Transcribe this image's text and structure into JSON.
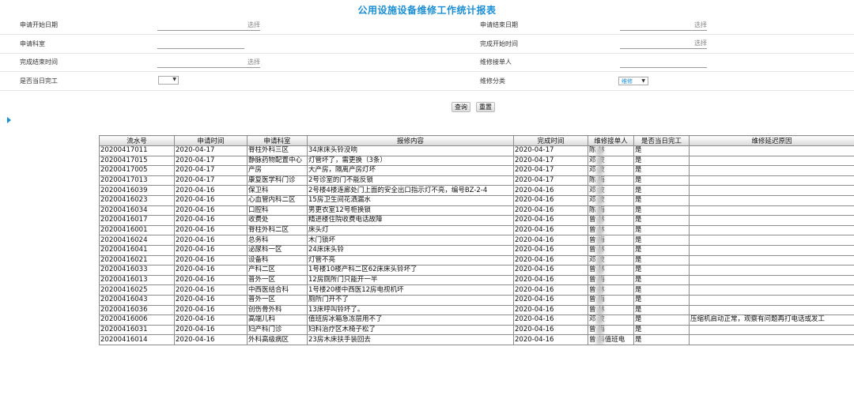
{
  "title": "公用设施设备维修工作统计报表",
  "form": {
    "start_date_label": "申请开始日期",
    "start_date_value": "选择",
    "end_date_label": "申请结束日期",
    "end_date_value": "选择",
    "dept_label": "申请科室",
    "finish_start_label": "完成开始时间",
    "finish_start_value": "选择",
    "finish_end_label": "完成结束时间",
    "finish_end_value": "选择",
    "receiver_label": "维修接单人",
    "same_day_label": "是否当日完工",
    "category_label": "维修分类",
    "category_value": "维修"
  },
  "buttons": {
    "query": "查询",
    "reset": "重置"
  },
  "table": {
    "headers": [
      "流水号",
      "申请时间",
      "申请科室",
      "报修内容",
      "完成时间",
      "维修接单人",
      "是否当日完工",
      "维修延迟原因"
    ],
    "rows": [
      [
        "20200417011",
        "2020-04-17",
        "脊柱外科三区",
        "34床床头铃没响",
        "2020-04-17",
        "陈 林",
        "是",
        ""
      ],
      [
        "20200417015",
        "2020-04-17",
        "静脉药物配置中心",
        "灯管坏了，需更换（3条）",
        "2020-04-17",
        "邓 波",
        "是",
        ""
      ],
      [
        "20200417005",
        "2020-04-17",
        "产房",
        "大产房，隔离产房灯坏",
        "2020-04-17",
        "邓 波",
        "是",
        ""
      ],
      [
        "20200417013",
        "2020-04-17",
        "康复医学科门诊",
        "2号诊室的门不能反锁",
        "2020-04-17",
        "陈 梅",
        "是",
        ""
      ],
      [
        "20200416039",
        "2020-04-16",
        "保卫科",
        "2号楼4楼连廊处门上面的安全出口指示灯不亮，编号BZ-2-4",
        "2020-04-16",
        "邓 波",
        "是",
        ""
      ],
      [
        "20200416023",
        "2020-04-16",
        "心血管内科二区",
        "15房卫生间花洒漏水",
        "2020-04-16",
        "邓 波",
        "是",
        ""
      ],
      [
        "20200416034",
        "2020-04-16",
        "口腔科",
        "男更衣室12号柜换锁",
        "2020-04-16",
        "陈 梅",
        "是",
        ""
      ],
      [
        "20200416017",
        "2020-04-16",
        "收费处",
        "精进楼住院收费电话故障",
        "2020-04-16",
        "曾 林",
        "是",
        ""
      ],
      [
        "20200416001",
        "2020-04-16",
        "脊柱外科二区",
        "床头灯",
        "2020-04-16",
        "曾 林",
        "是",
        ""
      ],
      [
        "20200416024",
        "2020-04-16",
        "总务科",
        "木门锁坏",
        "2020-04-16",
        "曾 梅",
        "是",
        ""
      ],
      [
        "20200416041",
        "2020-04-16",
        "泌尿科一区",
        "24床床头铃",
        "2020-04-16",
        "曾 林",
        "是",
        ""
      ],
      [
        "20200416021",
        "2020-04-16",
        "设备科",
        "灯管不亮",
        "2020-04-16",
        "邓 波",
        "是",
        ""
      ],
      [
        "20200416033",
        "2020-04-16",
        "产科二区",
        "1号楼10楼产科二区62床床头铃坏了",
        "2020-04-16",
        "曾 林",
        "是",
        ""
      ],
      [
        "20200416013",
        "2020-04-16",
        "普外一区",
        "12房厕所门只能开一半",
        "2020-04-16",
        "曾 梅",
        "是",
        ""
      ],
      [
        "20200416025",
        "2020-04-16",
        "中西医结合科",
        "1号楼20楼中西医12房电视机坏",
        "2020-04-16",
        "曾 林",
        "是",
        ""
      ],
      [
        "20200416043",
        "2020-04-16",
        "普外一区",
        "厕所门开不了",
        "2020-04-16",
        "曾 梅",
        "是",
        ""
      ],
      [
        "20200416036",
        "2020-04-16",
        "创伤骨外科",
        "13床呼叫铃坏了。",
        "2020-04-16",
        "曾 林",
        "是",
        ""
      ],
      [
        "20200416006",
        "2020-04-16",
        "高端儿科",
        "值班房冰箱急冻层用不了",
        "2020-04-16",
        "邓 波",
        "是",
        "压缩机启动正常，观察有问题再打电话或发工"
      ],
      [
        "20200416031",
        "2020-04-16",
        "妇产科门诊",
        "妇科治疗区木椅子松了",
        "2020-04-16",
        "曾 梅",
        "是",
        ""
      ],
      [
        "20200416014",
        "2020-04-16",
        "外科高级病区",
        "23房木床扶手装回去",
        "2020-04-16",
        "曾 科值班电",
        "是",
        ""
      ]
    ]
  },
  "colors": {
    "title": "#1a8fd6",
    "accent": "#1a8fd6"
  }
}
